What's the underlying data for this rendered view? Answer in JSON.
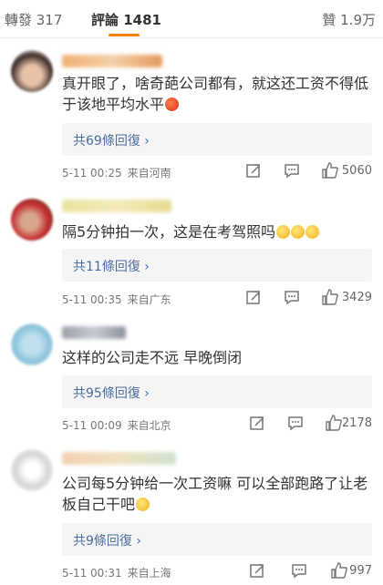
{
  "tabs": {
    "reposts": "轉發 317",
    "comments": "評論 1481",
    "likes": "贊 1.9万"
  },
  "comments": [
    {
      "text": "真开眼了，啥奇葩公司都有，就这还工资不得低于该地平均水平",
      "emoji": "angry-emoji",
      "replies_label": "共69條回復 ›",
      "time": "5-11 00:25",
      "location": "来自河南",
      "like_count": "5060"
    },
    {
      "text": "隔5分钟拍一次，这是在考驾照吗",
      "emoji": "sweat-emoji",
      "replies_label": "共11條回復 ›",
      "time": "5-11 00:35",
      "location": "来自广东",
      "like_count": "3429"
    },
    {
      "text": "这样的公司走不远 早晚倒闭",
      "replies_label": "共95條回復 ›",
      "time": "5-11 00:09",
      "location": "来自北京",
      "like_count": "2178"
    },
    {
      "text": "公司每5分钟给一次工资嘛 可以全部跑路了让老板自己干吧",
      "emoji": "speechless-emoji",
      "replies_label": "共9條回復 ›",
      "time": "5-11 00:31",
      "location": "来自上海",
      "like_count": "997"
    }
  ],
  "colors": {
    "accent": "#ff8200",
    "reply_link": "#4a6ea0"
  }
}
